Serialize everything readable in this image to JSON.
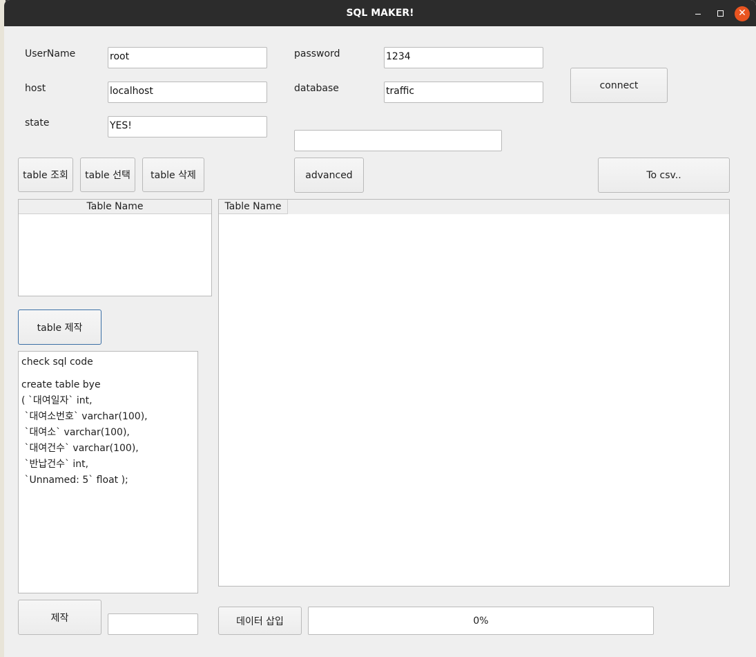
{
  "window": {
    "title": "SQL MAKER!",
    "minimize_icon": "minimize-icon",
    "maximize_icon": "maximize-icon",
    "close_icon": "close-icon",
    "accent": "#e95420"
  },
  "connection": {
    "username_label": "UserName",
    "username_value": "root",
    "password_label": "password",
    "password_value": "1234",
    "host_label": "host",
    "host_value": "localhost",
    "database_label": "database",
    "database_value": "traffic",
    "state_label": "state",
    "state_value": "YES!",
    "connect_button": "connect",
    "extra_input_value": ""
  },
  "toolbar": {
    "view_table": "table 조회",
    "select_table": "table 선택",
    "delete_table": "table 삭제",
    "advanced": "advanced",
    "to_csv": "To csv.."
  },
  "table_list": {
    "header": "Table Name"
  },
  "data_view": {
    "header": "Table Name"
  },
  "create_table_button": "table 제작",
  "sql_preview": {
    "heading": "check sql code",
    "lines": [
      "create table bye",
      "( `대여일자` int,",
      " `대여소번호` varchar(100),",
      " `대여소` varchar(100),",
      " `대여건수` varchar(100),",
      " `반납건수` int,",
      " `Unnamed: 5` float );"
    ]
  },
  "bottom": {
    "make_button": "제작",
    "make_input_value": "",
    "insert_data_button": "데이터 삽입",
    "progress_text": "0%",
    "progress_value": 0
  }
}
